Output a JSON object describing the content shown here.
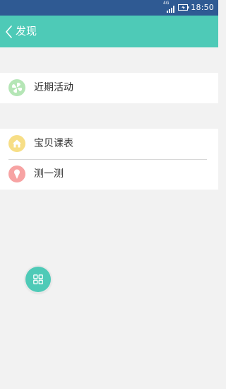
{
  "status_bar": {
    "network": "4G",
    "time": "18:50"
  },
  "header": {
    "title": "发现"
  },
  "menu_groups": [
    {
      "items": [
        {
          "label": "近期活动",
          "icon": "pinwheel-icon",
          "color": "#b5e6b6"
        }
      ]
    },
    {
      "items": [
        {
          "label": "宝贝课表",
          "icon": "house-icon",
          "color": "#f7de86"
        },
        {
          "label": "测一测",
          "icon": "ice-cream-icon",
          "color": "#f7a3a3"
        }
      ]
    }
  ],
  "floating_button": {
    "icon": "grid-icon",
    "color": "#4ecab7"
  },
  "colors": {
    "accent": "#4ecab7",
    "status_bar": "#2f5a93",
    "background": "#f2f2f2"
  }
}
